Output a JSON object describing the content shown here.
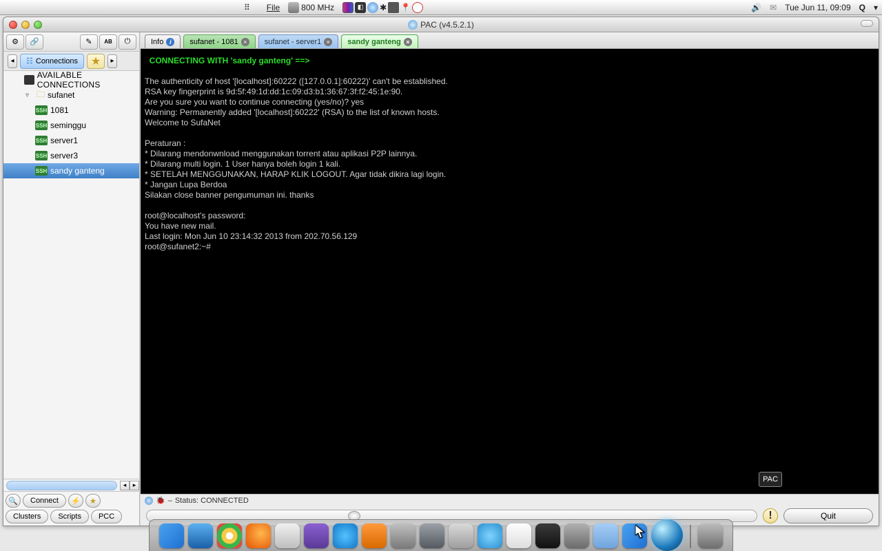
{
  "menubar": {
    "file": "File",
    "freq": "800 MHz",
    "clock": "Tue Jun 11, 09:09"
  },
  "window": {
    "title": "PAC (v4.5.2.1)"
  },
  "sidebar": {
    "tab_connections": "Connections",
    "header": "AVAILABLE CONNECTIONS",
    "group": "sufanet",
    "items": [
      "1081",
      "seminggu",
      "server1",
      "server3",
      "sandy ganteng"
    ],
    "selected_index": 4
  },
  "bottom": {
    "connect": "Connect",
    "clusters": "Clusters",
    "scripts": "Scripts",
    "pcc": "PCC"
  },
  "tabs": {
    "info": "Info",
    "t1": "sufanet - 1081",
    "t2": "sufanet - server1",
    "t3": "sandy ganteng"
  },
  "terminal": {
    "header": "  CONNECTING WITH 'sandy ganteng' ==>",
    "lines": [
      "",
      "The authenticity of host '[localhost]:60222 ([127.0.0.1]:60222)' can't be established.",
      "RSA key fingerprint is 9d:5f:49:1d:dd:1c:09:d3:b1:36:67:3f:f2:45:1e:90.",
      "Are you sure you want to continue connecting (yes/no)? yes",
      "Warning: Permanently added '[localhost]:60222' (RSA) to the list of known hosts.",
      "Welcome to SufaNet",
      "",
      "Peraturan :",
      "* Dilarang mendonwnload menggunakan torrent atau aplikasi P2P lainnya.",
      "* Dilarang multi login. 1 User hanya boleh login 1 kali.",
      "* SETELAH MENGGUNAKAN, HARAP KLIK LOGOUT. Agar tidak dikira lagi login.",
      "* Jangan Lupa Berdoa",
      "Silakan close banner pengumuman ini. thanks",
      "",
      "root@localhost's password:",
      "You have new mail.",
      "Last login: Mon Jun 10 23:14:32 2013 from 202.70.56.129",
      "root@sufanet2:~#"
    ]
  },
  "status": {
    "text": "Status: CONNECTED"
  },
  "badge": {
    "label": "PAC"
  },
  "footer": {
    "quit": "Quit"
  },
  "dock": {
    "apps": [
      {
        "name": "finder",
        "bg": "linear-gradient(135deg,#4aa3f0,#1f6fd1)"
      },
      {
        "name": "anchor",
        "bg": "linear-gradient(#5bb0f0,#1a5fa8)"
      },
      {
        "name": "chrome",
        "bg": "radial-gradient(circle,#fff 20%,#f7c948 21% 45%,#3bb54a 46% 70%,#e2483d 71%)"
      },
      {
        "name": "firefox",
        "bg": "radial-gradient(circle at 60% 40%,#ffb74d,#e65100)"
      },
      {
        "name": "mail",
        "bg": "linear-gradient(#f0f0f0,#bfbfbf)"
      },
      {
        "name": "pidgin",
        "bg": "linear-gradient(#8b5fd1,#5a3a96)"
      },
      {
        "name": "itunes",
        "bg": "radial-gradient(circle,#55c1ff,#1178c8)"
      },
      {
        "name": "vlc",
        "bg": "linear-gradient(#ff9a3c,#d86a00)"
      },
      {
        "name": "photos",
        "bg": "linear-gradient(#c0c0c0,#7a7a7a)"
      },
      {
        "name": "camera",
        "bg": "linear-gradient(#9aa0a6,#555a60)"
      },
      {
        "name": "calc",
        "bg": "linear-gradient(#dadada,#9e9e9e)"
      },
      {
        "name": "deluge",
        "bg": "radial-gradient(circle,#7fd4ff,#2a8fcf)"
      },
      {
        "name": "text",
        "bg": "linear-gradient(#fdfdfd,#dedede)"
      },
      {
        "name": "terminal",
        "bg": "linear-gradient(#3a3a3a,#111)"
      },
      {
        "name": "settings",
        "bg": "linear-gradient(#b0b0b0,#6b6b6b)"
      },
      {
        "name": "folder",
        "bg": "linear-gradient(#a6cdf6,#6fa4dc)"
      },
      {
        "name": "finder2",
        "bg": "linear-gradient(135deg,#4aa3f0,#1f6fd1)"
      }
    ]
  }
}
